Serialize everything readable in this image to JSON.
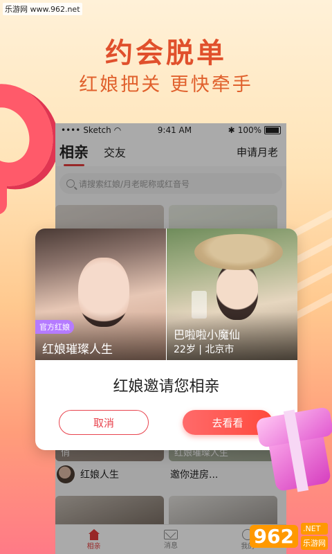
{
  "watermark": {
    "top": "乐游网 www.962.net",
    "bottom_num": "962",
    "bottom_net": ".NET",
    "bottom_txt": "乐游网"
  },
  "promo": {
    "headline": "约会脱单",
    "subline": "红娘把关 更快牵手"
  },
  "status_bar": {
    "carrier": "Sketch",
    "time": "9:41 AM",
    "battery": "100%"
  },
  "nav": {
    "tab_active": "相亲",
    "tab_other": "交友",
    "apply": "申请月老"
  },
  "search": {
    "placeholder": "请搜索红娘/月老昵称或红音号"
  },
  "list": {
    "row1_left_caption": "俏",
    "row1_right_caption": "红娘璀璨人生",
    "user_left": "红娘人生",
    "user_right": "邀你进房..."
  },
  "tabbar": {
    "home": "相亲",
    "msg": "消息",
    "me": "我的"
  },
  "modal": {
    "badge": "官方红娘",
    "left_name": "红娘璀璨人生",
    "right_name": "巴啦啦小魔仙",
    "right_meta": "22岁 | 北京市",
    "title": "红娘邀请您相亲",
    "cancel": "取消",
    "confirm": "去看看"
  },
  "colors": {
    "accent": "#e8434d",
    "headline": "#e0502c",
    "badge": "#b57bff"
  }
}
